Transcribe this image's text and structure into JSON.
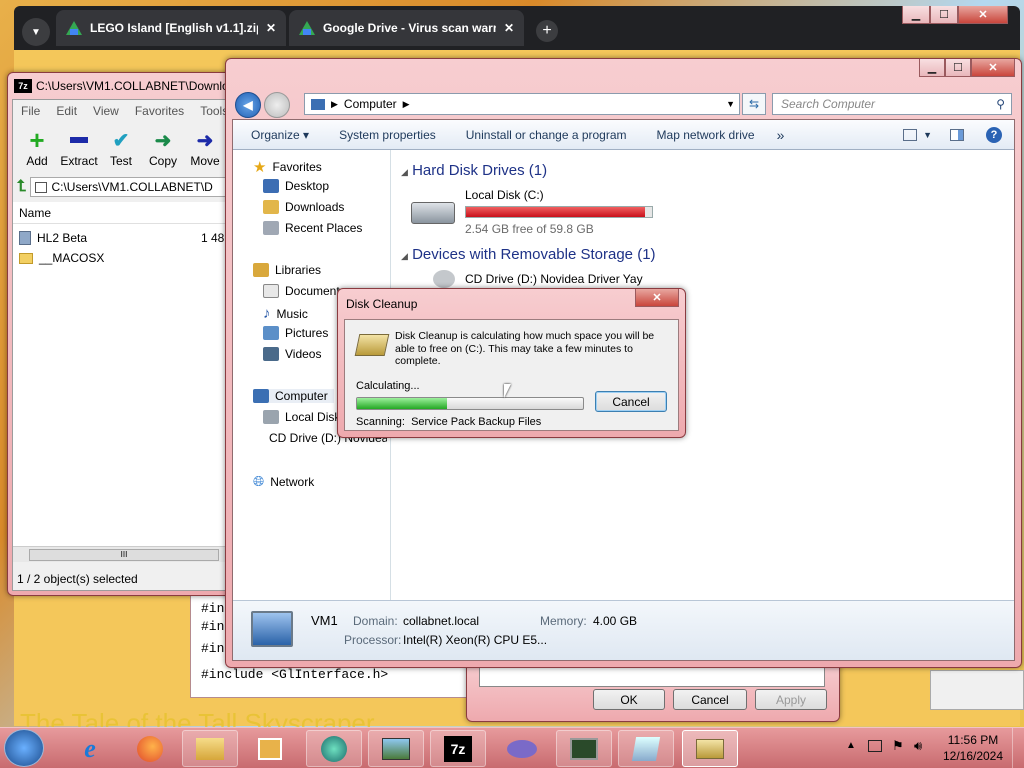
{
  "chrome": {
    "tabs": [
      {
        "label": "LEGO Island [English v1.1].zip"
      },
      {
        "label": "Google Drive - Virus scan warn"
      }
    ],
    "tab_close": "✕",
    "new_tab": "+"
  },
  "zip": {
    "title": "C:\\Users\\VM1.COLLABNET\\Downlo",
    "menu": [
      "File",
      "Edit",
      "View",
      "Favorites",
      "Tools"
    ],
    "toolbar": [
      {
        "label": "Add",
        "icon": "add-icon"
      },
      {
        "label": "Extract",
        "icon": "extract-icon"
      },
      {
        "label": "Test",
        "icon": "test-icon"
      },
      {
        "label": "Copy",
        "icon": "copy-icon"
      },
      {
        "label": "Move",
        "icon": "move-icon"
      }
    ],
    "path": "C:\\Users\\VM1.COLLABNET\\D",
    "col_name": "Name",
    "rows": [
      {
        "name": "HL2 Beta",
        "size": "1 48"
      },
      {
        "name": "__MACOSX",
        "size": ""
      }
    ],
    "status": "1 / 2 object(s) selected",
    "scroll_grip": "III"
  },
  "explorer": {
    "address": "Computer",
    "search_placeholder": "Search Computer",
    "cmd": [
      "Organize",
      "System properties",
      "Uninstall or change a program",
      "Map network drive"
    ],
    "more": "»",
    "nav": {
      "favorites": "Favorites",
      "desktop": "Desktop",
      "downloads": "Downloads",
      "recent": "Recent Places",
      "libraries": "Libraries",
      "documents": "Documents",
      "music": "Music",
      "pictures": "Pictures",
      "videos": "Videos",
      "computer": "Computer",
      "localdisk": "Local Disk (C:)",
      "cddrive": "CD Drive (D:) Novidea Driver Yay",
      "network": "Network"
    },
    "hdd_header": "Hard Disk Drives (1)",
    "disk_name": "Local Disk (C:)",
    "disk_free": "2.54 GB free of 59.8 GB",
    "disk_used_fraction": 0.96,
    "removable_header": "Devices with Removable Storage (1)",
    "cd_name": "CD Drive (D:) Novidea Driver Yay",
    "details": {
      "name": "VM1",
      "domain_label": "Domain:",
      "domain": "collabnet.local",
      "memory_label": "Memory:",
      "memory": "4.00 GB",
      "processor_label": "Processor:",
      "processor": "Intel(R) Xeon(R) CPU E5..."
    }
  },
  "background_window": {
    "code_lines": [
      "#in",
      "#in",
      "#in",
      "#include <GlInterface.h>"
    ],
    "ok": "OK",
    "cancel": "Cancel",
    "apply": "Apply",
    "banner": "The Tale of the Tall Skyscraper"
  },
  "dialog": {
    "title": "Disk Cleanup",
    "message": "Disk Cleanup is calculating how much space you will be able to free on  (C:). This may take a few minutes to complete.",
    "calculating": "Calculating...",
    "progress_fraction": 0.4,
    "cancel": "Cancel",
    "scanning_label": "Scanning:",
    "scanning_item": "Service Pack Backup Files"
  },
  "taskbar": {
    "time": "11:56 PM",
    "date": "12/16/2024",
    "zip_label": "7z"
  },
  "colors": {
    "disk_bar": "#d9222a",
    "progress": "#3ec43e",
    "titlebar_glass": "#eea9ae",
    "explorer_link": "#1e3287"
  }
}
